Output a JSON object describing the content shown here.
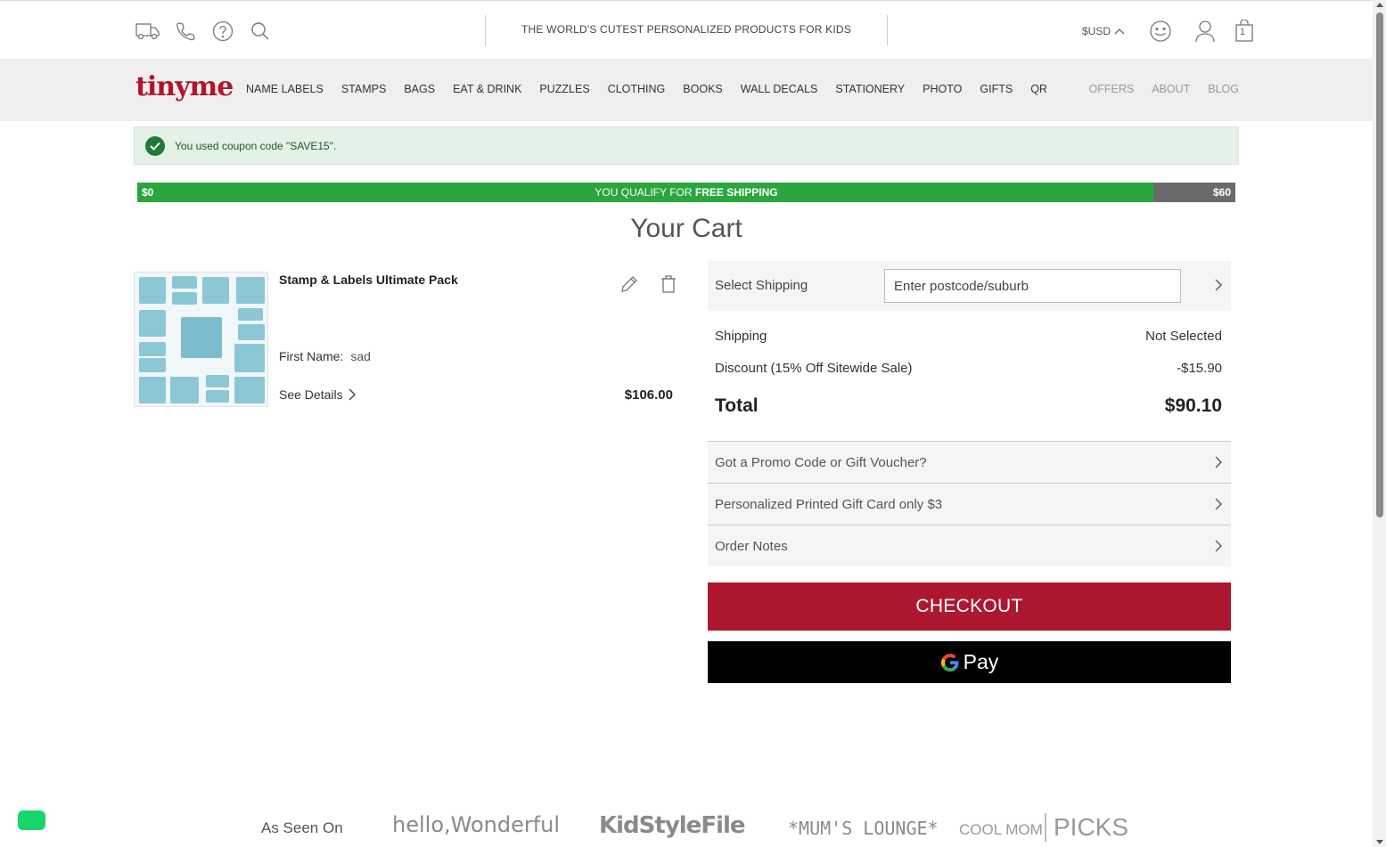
{
  "header": {
    "tagline": "THE WORLD'S CUTEST PERSONALIZED PRODUCTS FOR KIDS",
    "currency": "$USD",
    "cart_count": "1",
    "icons": [
      "delivery-truck-icon",
      "phone-icon",
      "help-icon",
      "search-icon",
      "smiley-icon",
      "user-icon",
      "shopping-bag-icon"
    ]
  },
  "nav": {
    "logo": "tinyme",
    "main": [
      "NAME LABELS",
      "STAMPS",
      "BAGS",
      "EAT & DRINK",
      "PUZZLES",
      "CLOTHING",
      "BOOKS",
      "WALL DECALS",
      "STATIONERY",
      "PHOTO",
      "GIFTS",
      "QR"
    ],
    "secondary": [
      "OFFERS",
      "ABOUT",
      "BLOG"
    ]
  },
  "coupon": {
    "message": "You used coupon code \"SAVE15\"."
  },
  "shipping_progress": {
    "min_label": "$0",
    "max_label": "$60",
    "message_prefix": "YOU QUALIFY FOR ",
    "message_bold": "FREE SHIPPING",
    "progress": 0.925,
    "fill_color": "#2ba63f"
  },
  "cart": {
    "title": "Your Cart",
    "item": {
      "name": "Stamp & Labels Ultimate Pack",
      "field_label": "First Name:",
      "field_value": "sad",
      "see_details": "See Details",
      "price": "$106.00"
    }
  },
  "summary": {
    "select_shipping_label": "Select Shipping",
    "postcode_placeholder": "Enter postcode/suburb",
    "shipping_label": "Shipping",
    "shipping_value": "Not Selected",
    "discount_label": "Discount (15% Off Sitewide Sale)",
    "discount_value": "-$15.90",
    "total_label": "Total",
    "total_value": "$90.10",
    "promo_label": "Got a Promo Code or Gift Voucher?",
    "giftcard_label": "Personalized Printed Gift Card only $3",
    "notes_label": "Order Notes",
    "checkout_label": "CHECKOUT",
    "gpay_label": "Pay",
    "checkout_color": "#ad1830"
  },
  "footer": {
    "as_seen_on": "As Seen On",
    "press": [
      "hello,Wonderful",
      "KidStyleFile",
      "*MUM'S LOUNGE*",
      "COOL MOM",
      "PICKS"
    ]
  }
}
